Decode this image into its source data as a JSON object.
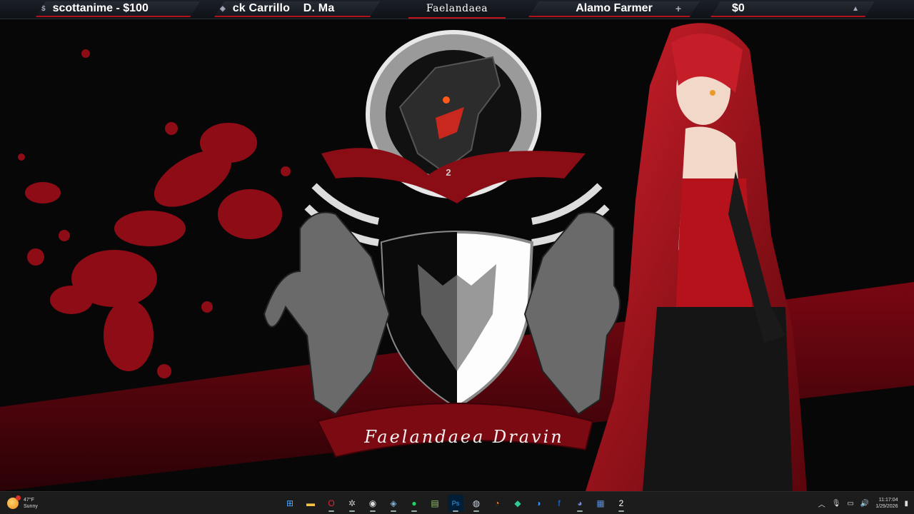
{
  "overlay": {
    "donor_text": "scottanime - $100",
    "donor_icon": "dollar-icon",
    "ticker_text": "ck Carrillo    D. Ma",
    "ticker_icon": "controller-icon",
    "logo_text": "Faelandaea",
    "follower_text": "Alamo Farmer",
    "follower_icon": "plus-icon",
    "money_text": "$0",
    "money_icon": "thumbs-up-icon",
    "accent_color": "#c0111b"
  },
  "wallpaper": {
    "banner_text": "Faelandaea Dravin",
    "crest_number": "2"
  },
  "taskbar": {
    "weather_temp": "47°F",
    "weather_cond": "Sunny",
    "apps": [
      {
        "name": "start-icon",
        "glyph": "⊞",
        "color": "#4aa8ff"
      },
      {
        "name": "file-explorer-icon",
        "glyph": "▬",
        "color": "#f5c242"
      },
      {
        "name": "opera-icon",
        "glyph": "O",
        "color": "#e0263a"
      },
      {
        "name": "app-icon-1",
        "glyph": "✲",
        "color": "#cccccc"
      },
      {
        "name": "obs-icon",
        "glyph": "◉",
        "color": "#dddddd"
      },
      {
        "name": "davinci-icon",
        "glyph": "◈",
        "color": "#7fb0d6"
      },
      {
        "name": "spotify-icon",
        "glyph": "●",
        "color": "#1ed760"
      },
      {
        "name": "notepad-icon",
        "glyph": "▤",
        "color": "#8fc46a"
      },
      {
        "name": "photoshop-icon",
        "glyph": "Ps",
        "color": "#31a8ff"
      },
      {
        "name": "steam-icon",
        "glyph": "◍",
        "color": "#c7d5e0"
      },
      {
        "name": "blender-icon",
        "glyph": "◔",
        "color": "#f5792a"
      },
      {
        "name": "app-icon-2",
        "glyph": "◆",
        "color": "#2ecc9a"
      },
      {
        "name": "messenger-icon",
        "glyph": "◑",
        "color": "#3a8dff"
      },
      {
        "name": "facebook-icon",
        "glyph": "f",
        "color": "#1877f2"
      },
      {
        "name": "discord-icon",
        "glyph": "◕",
        "color": "#7289da"
      },
      {
        "name": "calculator-icon",
        "glyph": "▦",
        "color": "#5b8fd6"
      },
      {
        "name": "notification-app-icon",
        "glyph": "2",
        "color": "#ffffff"
      }
    ],
    "time": "11:17:04",
    "date": "1/29/2026"
  }
}
